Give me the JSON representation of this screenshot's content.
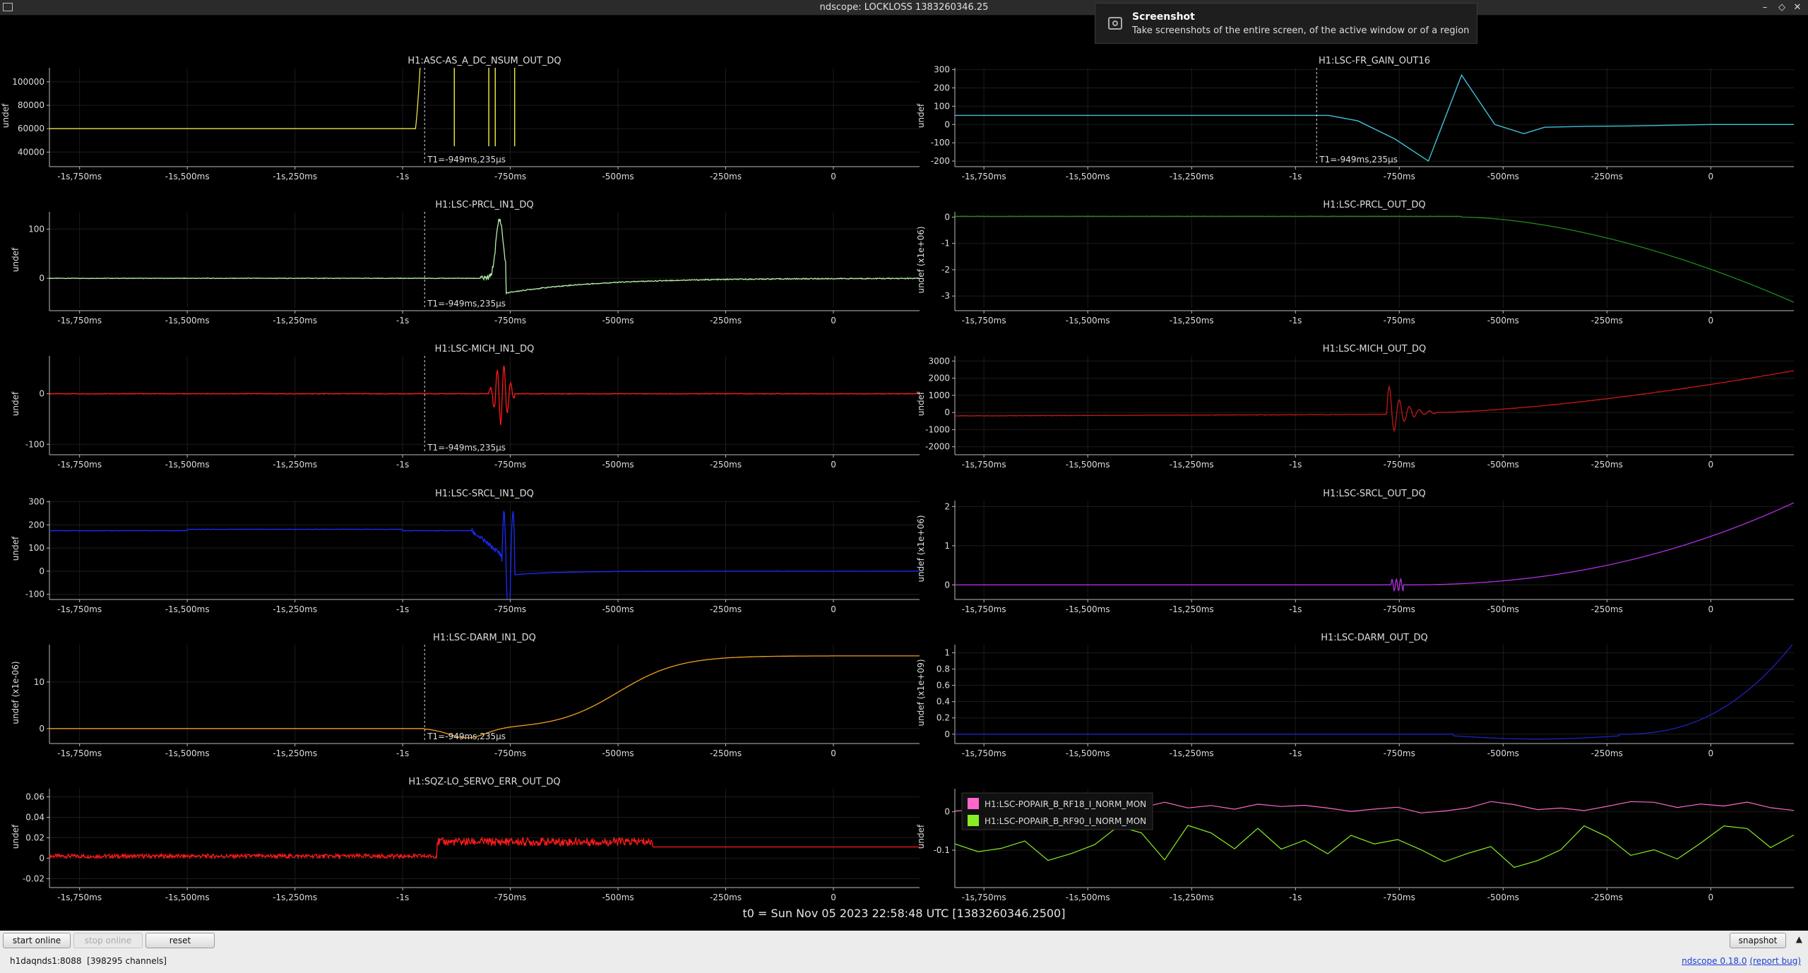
{
  "window": {
    "title": "ndscope: LOCKLOSS 1383260346.25",
    "minimize_glyph": "–",
    "maximize_glyph": "◇",
    "close_glyph": "✕"
  },
  "notification": {
    "title": "Screenshot",
    "message": "Take screenshots of the entire screen, of the active window or of a region"
  },
  "cursor_label": "T1=-949ms,235µs",
  "t0_label": "t0 = Sun Nov 05 2023 22:58:48 UTC [1383260346.2500]",
  "buttons": {
    "start_online": "start online",
    "stop_online": "stop online",
    "reset": "reset",
    "snapshot": "snapshot",
    "expand_glyph": "▲"
  },
  "status": {
    "server": "h1daqnds1:8088",
    "channels": "[398295 channels]",
    "version": "ndscope 0.18.0",
    "report_bug": "(report bug)"
  },
  "x_axis": {
    "range_s": [
      -1.82,
      0.2
    ],
    "tick_values": [
      -1.75,
      -1.5,
      -1.25,
      -1.0,
      -0.75,
      -0.5,
      -0.25,
      0
    ],
    "tick_labels": [
      "-1s,750ms",
      "-1s,500ms",
      "-1s,250ms",
      "-1s",
      "-750ms",
      "-500ms",
      "-250ms",
      "0"
    ],
    "cursor_t": -0.949
  },
  "plots": [
    {
      "name": "plot-asc-as-a-dc-nsum",
      "col": 0,
      "row": 0,
      "title": "H1:ASC-AS_A_DC_NSUM_OUT_DQ",
      "ylabel": "undef",
      "ylim": [
        30000,
        112000
      ],
      "yticks": [
        40000,
        60000,
        80000,
        100000
      ],
      "ytick_labels": [
        "40000",
        "60000",
        "80000",
        "100000"
      ],
      "color": "#e8e040",
      "cursor": true,
      "shape": "asc"
    },
    {
      "name": "plot-lsc-prcl-in1",
      "col": 0,
      "row": 1,
      "title": "H1:LSC-PRCL_IN1_DQ",
      "ylabel": "undef",
      "ylim": [
        -60,
        135
      ],
      "yticks": [
        0,
        100
      ],
      "ytick_labels": [
        "0",
        "100"
      ],
      "color": "#b4f0a8",
      "cursor": true,
      "shape": "prcl_in"
    },
    {
      "name": "plot-lsc-mich-in1",
      "col": 0,
      "row": 2,
      "title": "H1:LSC-MICH_IN1_DQ",
      "ylabel": "undef",
      "ylim": [
        -115,
        75
      ],
      "yticks": [
        -100,
        0
      ],
      "ytick_labels": [
        "-100",
        "0"
      ],
      "color": "#ff1a1a",
      "cursor": true,
      "shape": "mich_in"
    },
    {
      "name": "plot-lsc-srcl-in1",
      "col": 0,
      "row": 3,
      "title": "H1:LSC-SRCL_IN1_DQ",
      "ylabel": "undef",
      "ylim": [
        -110,
        305
      ],
      "yticks": [
        -100,
        0,
        100,
        200,
        300
      ],
      "ytick_labels": [
        "-100",
        "0",
        "100",
        "200",
        "300"
      ],
      "color": "#1a2cff",
      "cursor": false,
      "shape": "srcl_in"
    },
    {
      "name": "plot-lsc-darm-in1",
      "col": 0,
      "row": 4,
      "title": "H1:LSC-DARM_IN1_DQ",
      "ylabel": "undef (x1e-06)",
      "ylim": [
        -2.6,
        18
      ],
      "yticks": [
        0,
        10
      ],
      "ytick_labels": [
        "0",
        "10"
      ],
      "color": "#f0a020",
      "cursor": true,
      "shape": "darm_in"
    },
    {
      "name": "plot-sqz-lo-servo-err",
      "col": 0,
      "row": 5,
      "title": "H1:SQZ-LO_SERVO_ERR_OUT_DQ",
      "ylabel": "undef",
      "ylim": [
        -0.026,
        0.068
      ],
      "yticks": [
        -0.02,
        0,
        0.02,
        0.04,
        0.06
      ],
      "ytick_labels": [
        "-0.02",
        "0",
        "0.02",
        "0.04",
        "0.06"
      ],
      "color": "#ff1a1a",
      "cursor": false,
      "shape": "sqz"
    },
    {
      "name": "plot-lsc-fr-gain-out",
      "col": 1,
      "row": 0,
      "title": "H1:LSC-FR_GAIN_OUT16",
      "ylabel": "undef",
      "ylim": [
        -215,
        310
      ],
      "yticks": [
        -200,
        -100,
        0,
        100,
        200,
        300
      ],
      "ytick_labels": [
        "-200",
        "-100",
        "0",
        "100",
        "200",
        "300"
      ],
      "color": "#40c0d8",
      "cursor": true,
      "shape": "fr_gain"
    },
    {
      "name": "plot-lsc-prcl-out",
      "col": 1,
      "row": 1,
      "title": "H1:LSC-PRCL_OUT_DQ",
      "ylabel": "undef (x1e+06)",
      "ylim": [
        -3.45,
        0.2
      ],
      "yticks": [
        -3,
        -2,
        -1,
        0
      ],
      "ytick_labels": [
        "-3",
        "-2",
        "-1",
        "0"
      ],
      "color": "#1e8a1e",
      "cursor": false,
      "shape": "prcl_out"
    },
    {
      "name": "plot-lsc-mich-out",
      "col": 1,
      "row": 2,
      "title": "H1:LSC-MICH_OUT_DQ",
      "ylabel": "undef",
      "ylim": [
        -2300,
        3300
      ],
      "yticks": [
        -2000,
        -1000,
        0,
        1000,
        2000,
        3000
      ],
      "ytick_labels": [
        "-2000",
        "-1000",
        "0",
        "1000",
        "2000",
        "3000"
      ],
      "color": "#c01818",
      "cursor": false,
      "shape": "mich_out"
    },
    {
      "name": "plot-lsc-srcl-out",
      "col": 1,
      "row": 3,
      "title": "H1:LSC-SRCL_OUT_DQ",
      "ylabel": "undef (x1e+06)",
      "ylim": [
        -0.3,
        2.15
      ],
      "yticks": [
        0,
        1,
        2
      ],
      "ytick_labels": [
        "0",
        "1",
        "2"
      ],
      "color": "#b030e0",
      "cursor": false,
      "shape": "srcl_out"
    },
    {
      "name": "plot-lsc-darm-out",
      "col": 1,
      "row": 4,
      "title": "H1:LSC-DARM_OUT_DQ",
      "ylabel": "undef (x1e+09)",
      "ylim": [
        -0.08,
        1.1
      ],
      "yticks": [
        0,
        0.2,
        0.4,
        0.6,
        0.8,
        1
      ],
      "ytick_labels": [
        "0",
        "0.2",
        "0.4",
        "0.6",
        "0.8",
        "1"
      ],
      "color": "#2020c0",
      "cursor": false,
      "shape": "darm_out"
    },
    {
      "name": "plot-lsc-popair-norm",
      "col": 1,
      "row": 5,
      "title": "",
      "ylabel": "undef",
      "ylim": [
        -0.19,
        0.06
      ],
      "yticks": [
        -0.1,
        0
      ],
      "ytick_labels": [
        "-0.1",
        "0"
      ],
      "color": "#a8e040",
      "cursor": false,
      "shape": "popair",
      "legend": [
        {
          "label": "H1:LSC-POPAIR_B_RF18_I_NORM_MON",
          "color": "#ff66cc"
        },
        {
          "label": "H1:LSC-POPAIR_B_RF90_I_NORM_MON",
          "color": "#88ee22"
        }
      ]
    }
  ]
}
